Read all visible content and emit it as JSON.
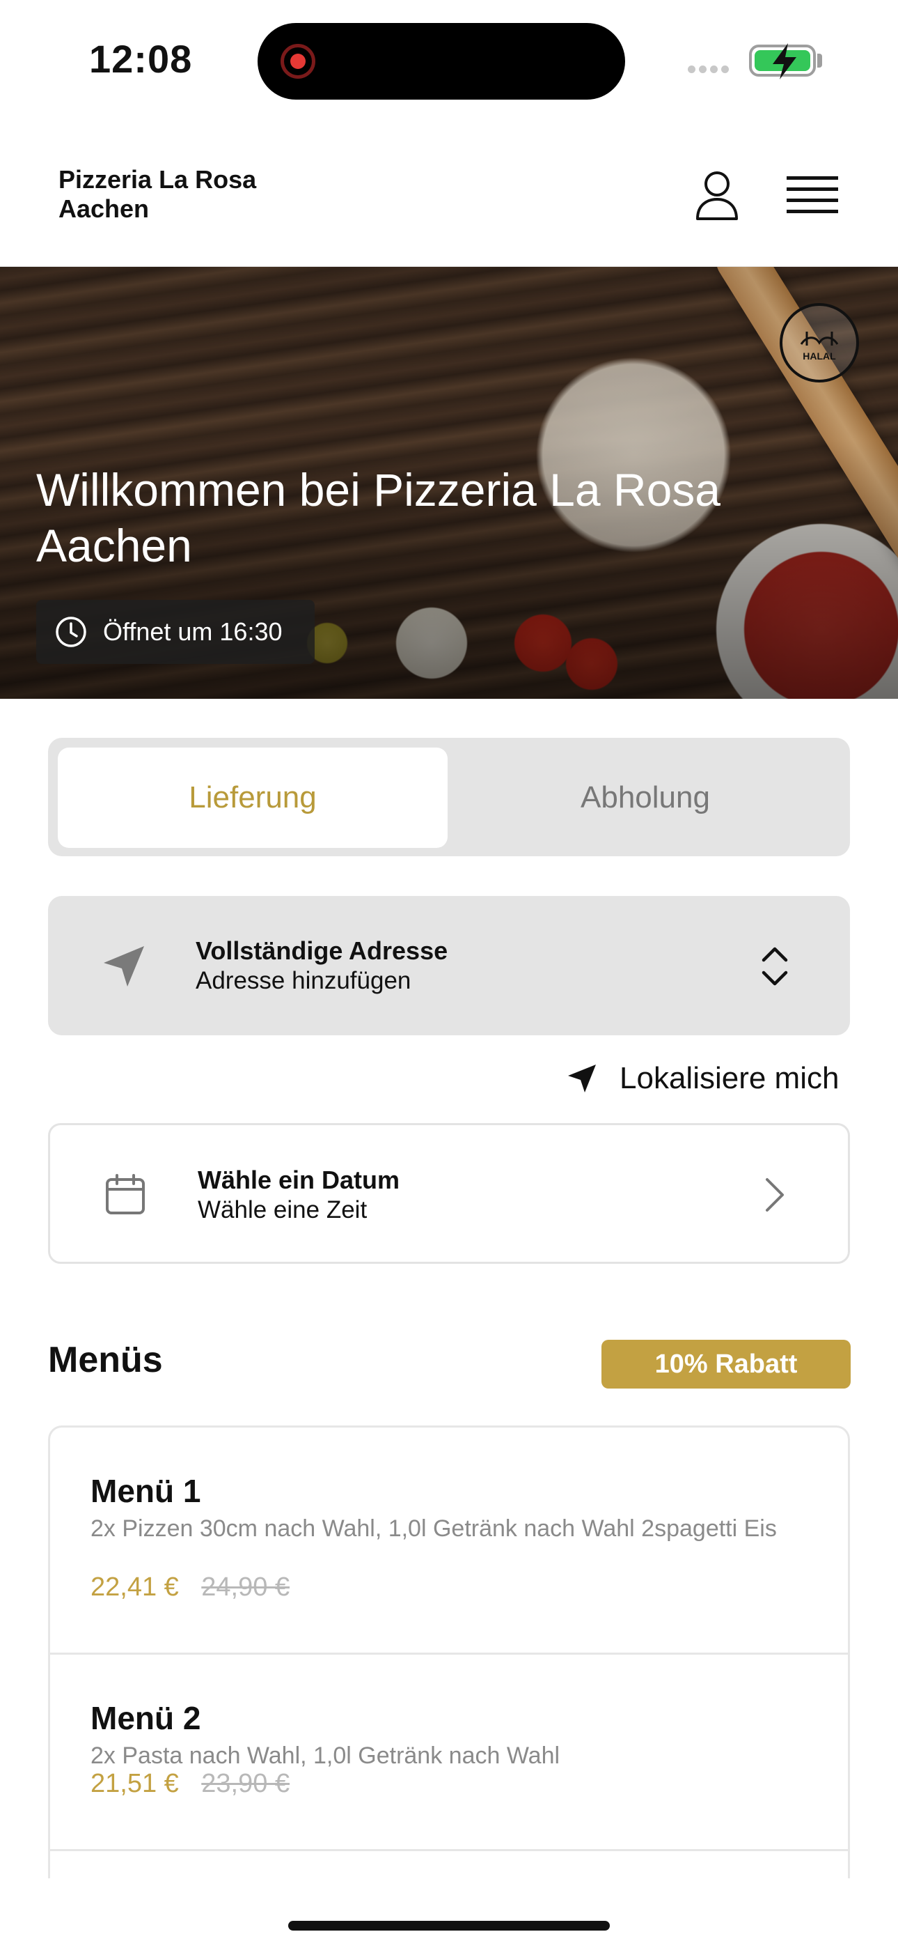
{
  "status_bar": {
    "time": "12:08"
  },
  "header": {
    "brand": "Pizzeria La Rosa Aachen"
  },
  "hero": {
    "title": "Willkommen bei Pizzeria La Rosa Aachen",
    "opening": "Öffnet um 16:30",
    "badge_text": "HALAL"
  },
  "order_mode": {
    "options": [
      "Lieferung",
      "Abholung"
    ],
    "selected": "Lieferung"
  },
  "address": {
    "title": "Vollständige Adresse",
    "subtitle": "Adresse hinzufügen"
  },
  "locate_label": "Lokalisiere mich",
  "date_picker": {
    "title": "Wähle ein Datum",
    "subtitle": "Wähle eine Zeit"
  },
  "menus": {
    "title": "Menüs",
    "discount": "10% Rabatt",
    "items": [
      {
        "name": "Menü 1",
        "description": "2x Pizzen 30cm nach Wahl, 1,0l Getränk nach Wahl 2spagetti Eis",
        "price": "22,41 €",
        "old_price": "24,90 €"
      },
      {
        "name": "Menü 2",
        "description": "2x Pasta nach Wahl, 1,0l Getränk nach Wahl",
        "price": "21,51 €",
        "old_price": "23,90 €"
      }
    ]
  },
  "colors": {
    "accent": "#c3a142",
    "segment_bg": "#e4e4e4",
    "battery": "#34c759"
  },
  "icons": [
    "user-icon",
    "hamburger-menu-icon",
    "clock-icon",
    "location-arrow-icon",
    "up-down-chevron-icon",
    "navigation-arrow-icon",
    "calendar-icon",
    "chevron-right-icon",
    "halal-badge-icon"
  ]
}
